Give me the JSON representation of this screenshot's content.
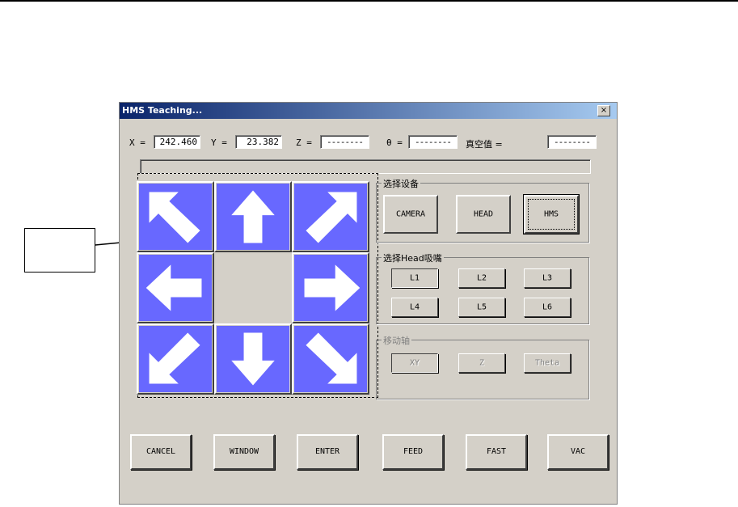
{
  "dialog": {
    "title": "HMS Teaching...",
    "close_glyph": "×"
  },
  "coords": {
    "x_label": "X =",
    "x_value": "242.460",
    "y_label": "Y =",
    "y_value": "23.382",
    "z_label": "Z =",
    "z_value": "--------",
    "theta_label": "θ =",
    "theta_value": "--------",
    "vacuum_label": "真空值 =",
    "vacuum_value": "--------"
  },
  "device_group": {
    "title": "选择设备",
    "buttons": [
      "CAMERA",
      "HEAD",
      "HMS"
    ],
    "selected": "HMS"
  },
  "head_group": {
    "title": "选择Head吸嘴",
    "buttons": [
      "L1",
      "L2",
      "L3",
      "L4",
      "L5",
      "L6"
    ],
    "selected": "L1"
  },
  "axis_group": {
    "title": "移动轴",
    "buttons": [
      "XY",
      "Z",
      "Theta"
    ],
    "enabled": false
  },
  "direction_pad": {
    "icons": [
      "arrow-up-left-icon",
      "arrow-up-icon",
      "arrow-up-right-icon",
      "arrow-left-icon",
      "arrow-right-icon",
      "arrow-down-left-icon",
      "arrow-down-icon",
      "arrow-down-right-icon"
    ],
    "face_color": "#6868ff"
  },
  "bottom_buttons": [
    "CANCEL",
    "WINDOW",
    "ENTER",
    "FEED",
    "FAST",
    "VAC"
  ]
}
